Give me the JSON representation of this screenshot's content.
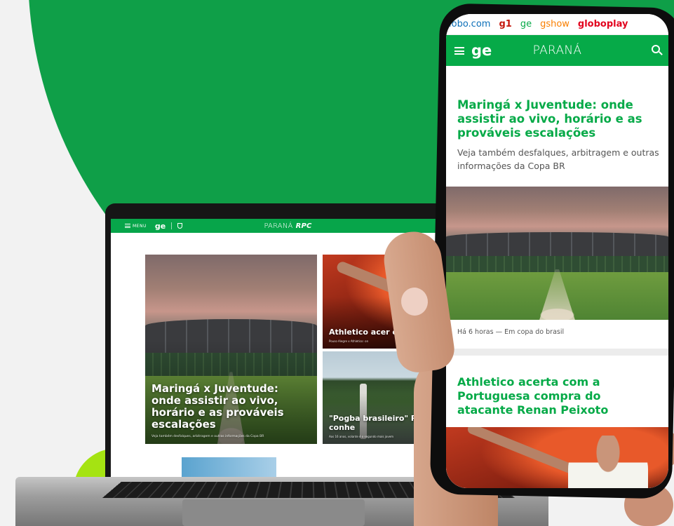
{
  "colors": {
    "brand_green": "#06aa48",
    "background_green": "#0f9f48",
    "lime_accent": "#a5e312"
  },
  "laptop": {
    "menu_label": "MENU",
    "logo": "ge",
    "region": "PARANÁ",
    "affiliate": "RPC",
    "main_story": {
      "headline": "Maringá x Juventude: onde assistir ao vivo, horário e as prováveis escalações",
      "summary": "Veja também desfalques, arbitragem e outras informações da Copa BR"
    },
    "side_story_1": {
      "headline": "Athletico acer compra do ata",
      "summary": "Pouso Alegre x Athletico: on"
    },
    "side_story_2": {
      "headline": "\"Pogba brasileiro\" Ronaldinho: conhe",
      "summary": "Aos 16 anos, volante é o segundo mais jovem"
    }
  },
  "phone": {
    "portals": [
      "lobo.com",
      "g1",
      "ge",
      "gshow",
      "globoplay"
    ],
    "logo": "ge",
    "region": "PARANÁ",
    "story_1": {
      "headline": "Maringá x Juventude: onde assistir ao vivo, horário e as prováveis escalações",
      "summary": "Veja também desfalques, arbitragem e outras informações da Copa BR",
      "meta": "Há 6 horas — Em copa do brasil"
    },
    "story_2": {
      "headline": "Athletico acerta com a Portuguesa compra do atacante Renan Peixoto"
    }
  },
  "icons": {
    "menu": "hamburger-icon",
    "search": "search-icon",
    "shield": "shield-icon"
  }
}
